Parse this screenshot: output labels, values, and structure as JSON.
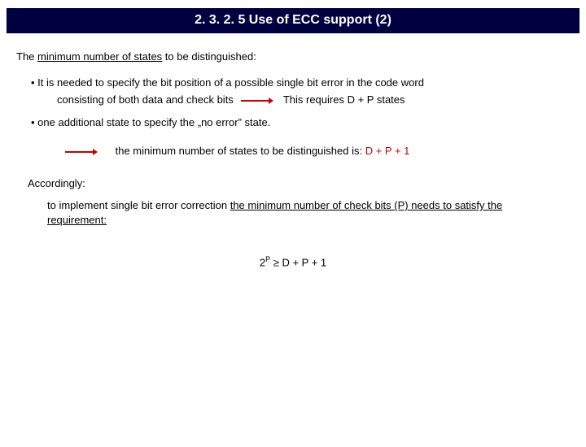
{
  "title": "2. 3. 2. 5 Use of ECC support (2)",
  "intro_pre": "The ",
  "intro_u": "minimum number of states",
  "intro_post": " to be distinguished:",
  "b1_line1": "• It is needed to specify the bit position of a possible single bit error in the code word",
  "b1_sub_pre": "consisting of both data and check bits",
  "b1_sub_post": "This requires D + P states",
  "b2": "• one additional state to specify the „no error” state.",
  "min_text": "the minimum number of states to be distinguished is: ",
  "min_expr": "D + P + 1",
  "accordingly": "Accordingly:",
  "impl_pre": "to implement single bit error correction ",
  "impl_u": "the minimum number of check bits (P) needs to satisfy the requirement:",
  "formula_pre": "2",
  "formula_sup": "P",
  "formula_post": " ≥ D + P + 1"
}
